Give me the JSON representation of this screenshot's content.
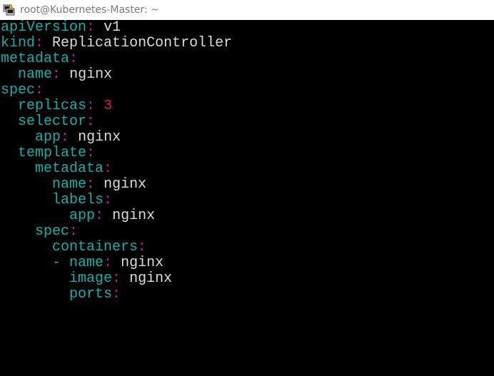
{
  "window": {
    "title": "root@Kubernetes-Master: ~"
  },
  "colors": {
    "key": "#14b0aa",
    "colon": "#c0169f",
    "value": "#dcdcdc",
    "number": "#d02020",
    "background": "#000000"
  },
  "lines": [
    {
      "indent": "",
      "key": "apiVersion",
      "colon": ":",
      "sep": " ",
      "value": "v1"
    },
    {
      "indent": "",
      "key": "kind",
      "colon": ":",
      "sep": " ",
      "value": "ReplicationController"
    },
    {
      "indent": "",
      "key": "metadata",
      "colon": ":",
      "sep": "",
      "value": ""
    },
    {
      "indent": "  ",
      "key": "name",
      "colon": ":",
      "sep": " ",
      "value": "nginx"
    },
    {
      "indent": "",
      "key": "spec",
      "colon": ":",
      "sep": "",
      "value": ""
    },
    {
      "indent": "  ",
      "key": "replicas",
      "colon": ":",
      "sep": " ",
      "number": "3"
    },
    {
      "indent": "  ",
      "key": "selector",
      "colon": ":",
      "sep": "",
      "value": ""
    },
    {
      "indent": "    ",
      "key": "app",
      "colon": ":",
      "sep": " ",
      "value": "nginx"
    },
    {
      "indent": "  ",
      "key": "template",
      "colon": ":",
      "sep": "",
      "value": ""
    },
    {
      "indent": "    ",
      "key": "metadata",
      "colon": ":",
      "sep": "",
      "value": ""
    },
    {
      "indent": "      ",
      "key": "name",
      "colon": ":",
      "sep": " ",
      "value": "nginx"
    },
    {
      "indent": "      ",
      "key": "labels",
      "colon": ":",
      "sep": "",
      "value": ""
    },
    {
      "indent": "        ",
      "key": "app",
      "colon": ":",
      "sep": " ",
      "value": "nginx"
    },
    {
      "indent": "    ",
      "key": "spec",
      "colon": ":",
      "sep": "",
      "value": ""
    },
    {
      "indent": "      ",
      "key": "containers",
      "colon": ":",
      "sep": "",
      "value": ""
    },
    {
      "indent": "      ",
      "dash": "- ",
      "key": "name",
      "colon": ":",
      "sep": " ",
      "value": "nginx"
    },
    {
      "indent": "        ",
      "key": "image",
      "colon": ":",
      "sep": " ",
      "value": "nginx"
    },
    {
      "indent": "        ",
      "key": "ports",
      "colon": ":",
      "sep": "",
      "value": ""
    }
  ]
}
